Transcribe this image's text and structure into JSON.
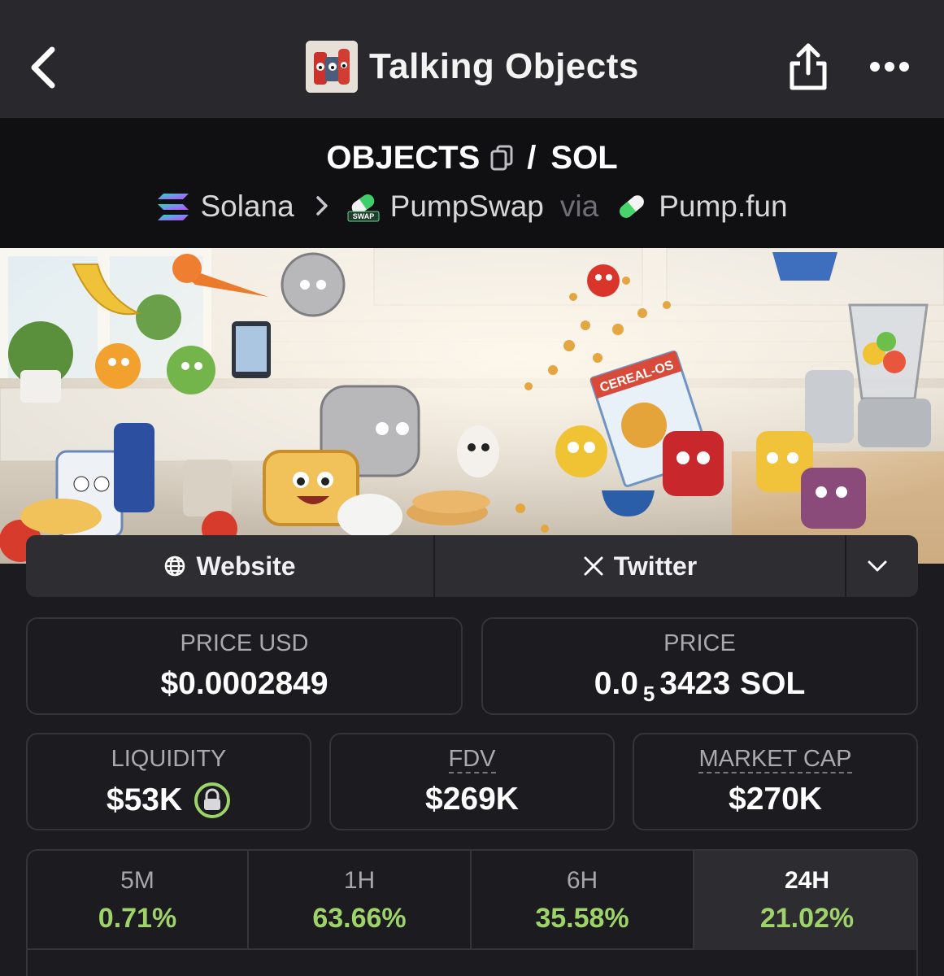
{
  "header": {
    "title": "Talking Objects",
    "back_icon": "chevron-left-icon",
    "share_icon": "share-icon",
    "more_icon": "more-horizontal-icon"
  },
  "pair": {
    "base": "OBJECTS",
    "separator": "/",
    "quote": "SOL",
    "chain": "Solana",
    "dex": "PumpSwap",
    "via_label": "via",
    "launchpad": "Pump.fun",
    "dex_badge": "SWAP"
  },
  "links": {
    "website_label": "Website",
    "twitter_label": "Twitter",
    "twitter_glyph": "X"
  },
  "banner": {
    "box_text": "CEREAL-OS"
  },
  "stats": {
    "price_usd": {
      "label": "PRICE USD",
      "value": "$0.0002849"
    },
    "price": {
      "label": "PRICE",
      "prefix": "0.0",
      "zeros": "5",
      "digits": "3423",
      "unit": "SOL"
    },
    "liquidity": {
      "label": "LIQUIDITY",
      "value": "$53K"
    },
    "fdv": {
      "label": "FDV",
      "value": "$269K"
    },
    "market_cap": {
      "label": "MARKET CAP",
      "value": "$270K"
    }
  },
  "timeframes": [
    {
      "label": "5M",
      "change": "0.71%",
      "active": false
    },
    {
      "label": "1H",
      "change": "63.66%",
      "active": false
    },
    {
      "label": "6H",
      "change": "35.58%",
      "active": false
    },
    {
      "label": "24H",
      "change": "21.02%",
      "active": true
    }
  ],
  "colors": {
    "positive": "#9ed36a",
    "lock_ring": "#9ed36a",
    "background": "#1b1b20",
    "nav": "#29292d"
  }
}
